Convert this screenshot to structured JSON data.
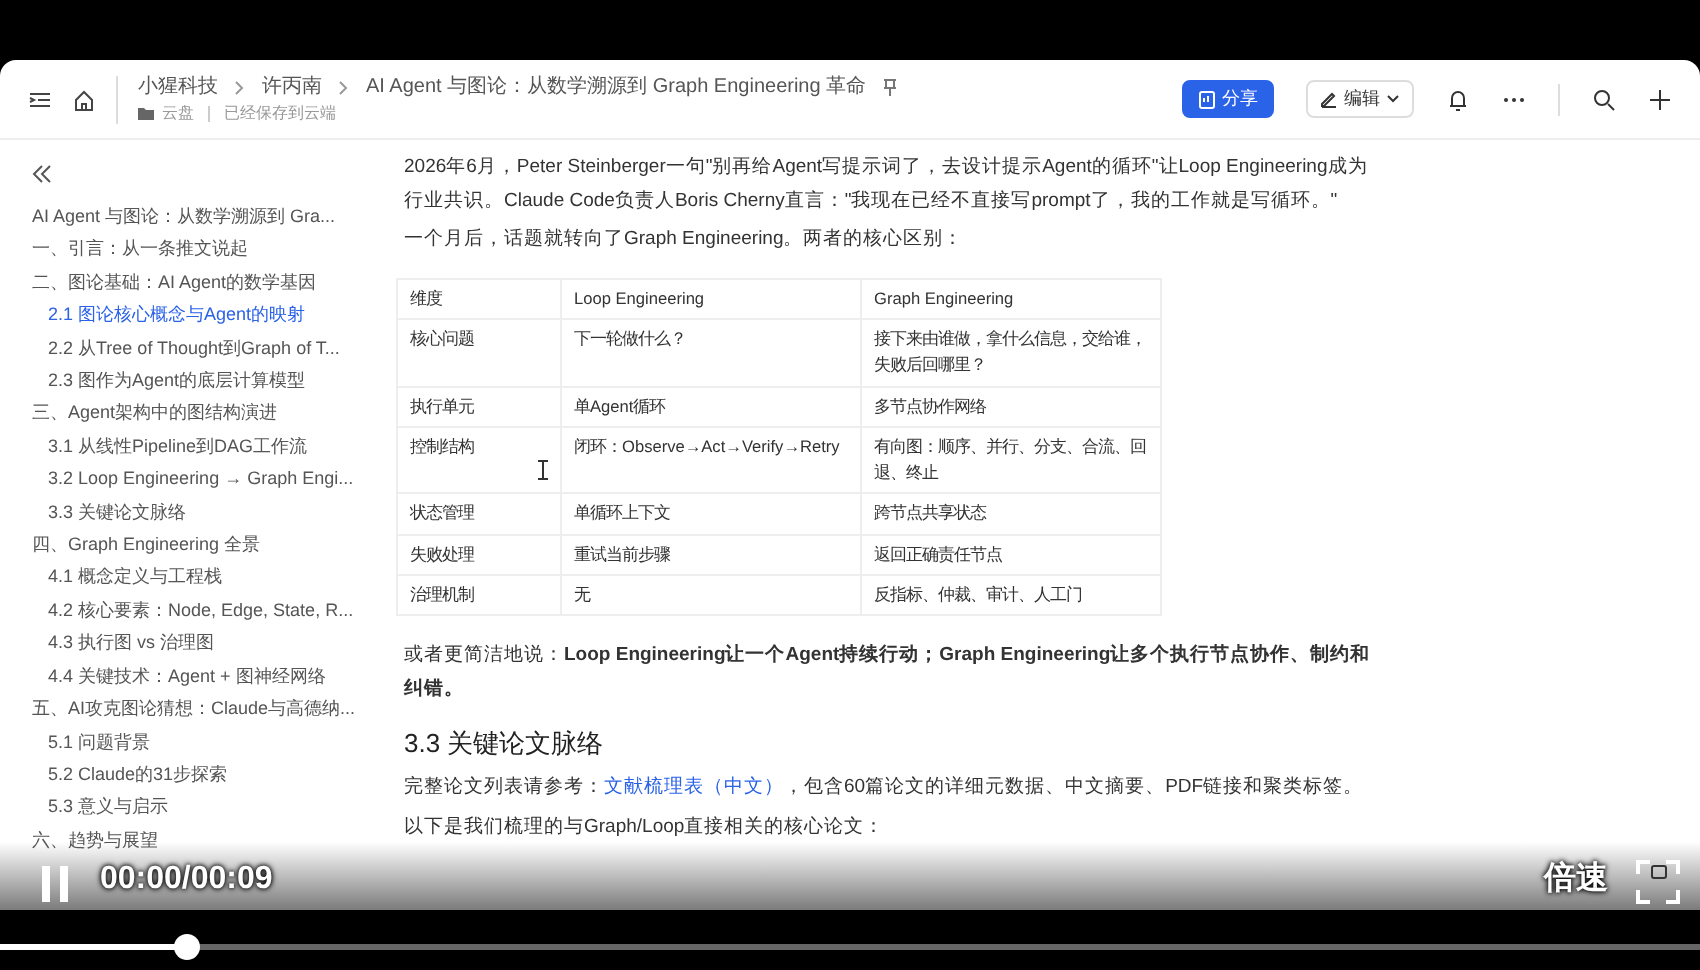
{
  "header": {
    "breadcrumb": [
      "小猩科技",
      "许丙南",
      "AI Agent 与图论：从数学溯源到 Graph Engineering 革命"
    ],
    "location": "云盘",
    "save_status": "已经保存到云端",
    "share_button": "分享",
    "edit_button": "编辑"
  },
  "sidebar": {
    "items": [
      {
        "label": "AI Agent 与图论：从数学溯源到 Gra...",
        "selected": false
      },
      {
        "label": "一、引言：从一条推文说起",
        "selected": false
      },
      {
        "label": "二、图论基础：AI Agent的数学基因",
        "selected": false,
        "children": [
          {
            "label": "2.1 图论核心概念与Agent的映射",
            "selected": true
          },
          {
            "label": "2.2 从Tree of Thought到Graph of T...",
            "selected": false
          },
          {
            "label": "2.3 图作为Agent的底层计算模型",
            "selected": false
          }
        ]
      },
      {
        "label": "三、Agent架构中的图结构演进",
        "selected": false,
        "children": [
          {
            "label": "3.1 从线性Pipeline到DAG工作流",
            "selected": false
          },
          {
            "label": "3.2 Loop Engineering → Graph Engi...",
            "selected": false
          },
          {
            "label": "3.3 关键论文脉络",
            "selected": false
          }
        ]
      },
      {
        "label": "四、Graph Engineering 全景",
        "selected": false,
        "children": [
          {
            "label": "4.1 概念定义与工程栈",
            "selected": false
          },
          {
            "label": "4.2 核心要素：Node, Edge, State, R...",
            "selected": false
          },
          {
            "label": "4.3 执行图 vs 治理图",
            "selected": false
          },
          {
            "label": "4.4 关键技术：Agent + 图神经网络",
            "selected": false
          }
        ]
      },
      {
        "label": "五、AI攻克图论猜想：Claude与高德纳...",
        "selected": false,
        "children": [
          {
            "label": "5.1 问题背景",
            "selected": false
          },
          {
            "label": "5.2 Claude的31步探索",
            "selected": false
          },
          {
            "label": "5.3 意义与启示",
            "selected": false
          }
        ]
      },
      {
        "label": "六、趋势与展望",
        "selected": false
      }
    ]
  },
  "document": {
    "intro": [
      "2026年6月，Peter Steinberger一句\"别再给Agent写提示词了，去设计提示Agent的循环\"让Loop Engineering成为行业共识。Claude Code负责人Boris Cherny直言：\"我现在已经不直接写prompt了，我的工作就是写循环。\"",
      "一个月后，话题就转向了Graph Engineering。两者的核心区别："
    ],
    "table": {
      "columns": [
        "维度",
        "Loop Engineering",
        "Graph Engineering"
      ],
      "rows": [
        [
          "核心问题",
          "下一轮做什么？",
          "接下来由谁做，拿什么信息，交给谁，失败后回哪里？"
        ],
        [
          "执行单元",
          "单Agent循环",
          "多节点协作网络"
        ],
        [
          "控制结构",
          "闭环：Observe→Act→Verify→Retry",
          "有向图：顺序、并行、分支、合流、回退、终止"
        ],
        [
          "状态管理",
          "单循环上下文",
          "跨节点共享状态"
        ],
        [
          "失败处理",
          "重试当前步骤",
          "返回正确责任节点"
        ],
        [
          "治理机制",
          "无",
          "反指标、仲裁、审计、人工门"
        ]
      ]
    },
    "summary": "或者更简洁地说：**Loop Engineering让一个Agent持续行动；Graph Engineering让多个执行节点协作、制约和纠错。**",
    "heading": "3.3 关键论文脉络",
    "reference": {
      "before": "完整论文列表请参考：",
      "link": "文献梳理表（中文）",
      "after": "，包含60篇论文的详细元数据、中文摘要、PDF链接和聚类标签。"
    },
    "lead_in": "以下是我们梳理的与Graph/Loop直接相关的核心论文："
  },
  "player": {
    "playing": true,
    "time": "00:00/00:09",
    "speed": "倍速",
    "progress": {
      "level": 0.11
    }
  }
}
